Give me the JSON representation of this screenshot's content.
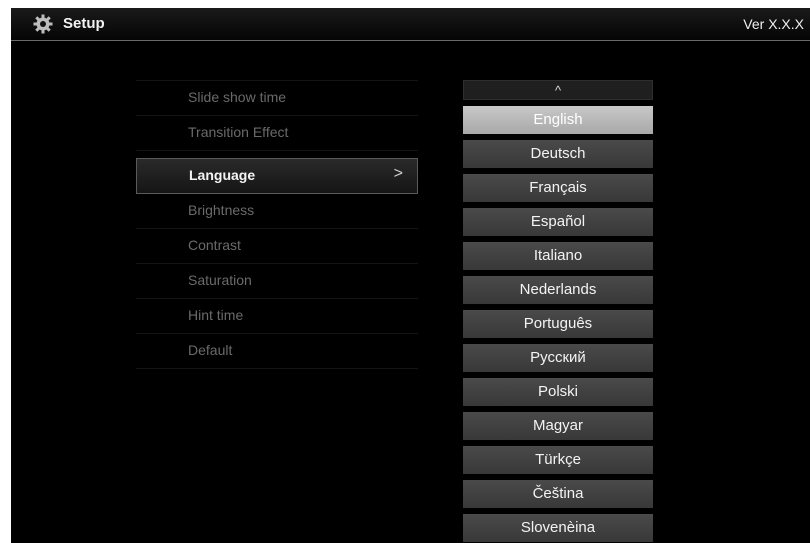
{
  "header": {
    "title": "Setup",
    "version": "Ver X.X.X",
    "icon": "gear-icon"
  },
  "menu": {
    "items": [
      {
        "label": "Slide show time"
      },
      {
        "label": "Transition Effect"
      },
      {
        "label": "Language",
        "selected": true,
        "arrow": ">"
      },
      {
        "label": "Brightness"
      },
      {
        "label": "Contrast"
      },
      {
        "label": "Saturation"
      },
      {
        "label": "Hint time"
      },
      {
        "label": "Default"
      }
    ]
  },
  "languages": {
    "scroll_up": "^",
    "items": [
      "English",
      "Deutsch",
      "Français",
      "Español",
      "Italiano",
      "Nederlands",
      "Português",
      "Русский",
      "Polski",
      "Magyar",
      "Türkçe",
      "Čeština",
      "Slovenèina"
    ],
    "selected": "English"
  },
  "colors": {
    "background": "#000000",
    "selected_language": "#b5b5b5",
    "language_button": "#424242"
  }
}
